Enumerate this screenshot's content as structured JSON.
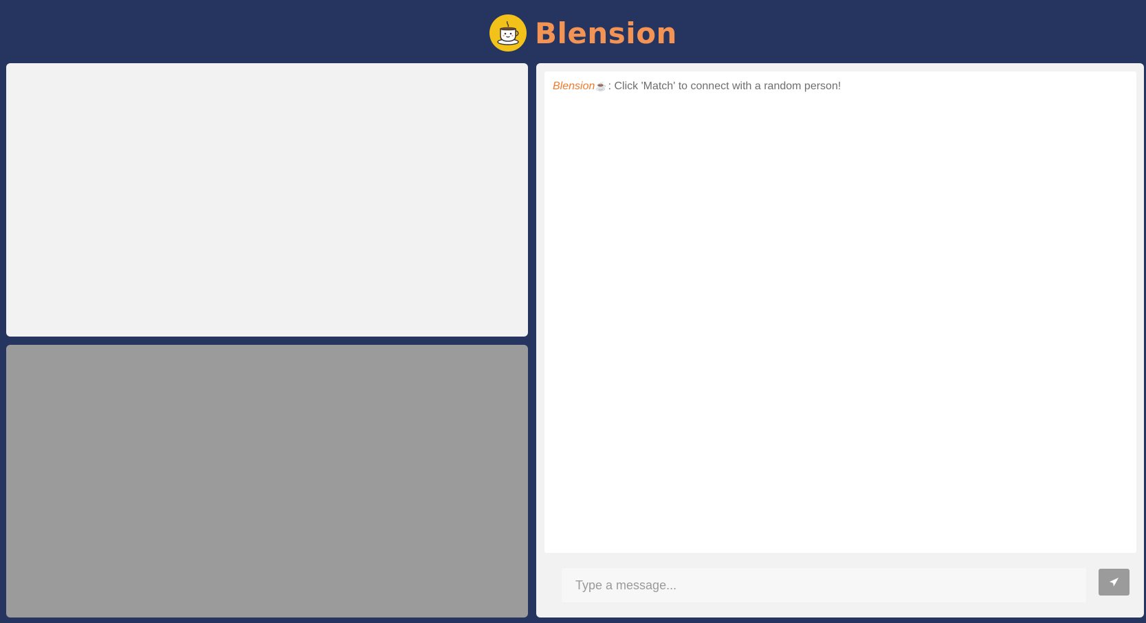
{
  "header": {
    "brand": "Blension",
    "logo_icon": "coffee-cup-mascot-icon",
    "logo_bg_color": "#f3c21a",
    "brand_color": "#f39455"
  },
  "background_color": "#263560",
  "video": {
    "local_bg_color": "#f2f2f2",
    "remote_bg_color": "#9b9b9b"
  },
  "chat": {
    "messages": [
      {
        "sender": "Blension",
        "sender_icon": "☕",
        "separator": ":",
        "text": "Click 'Match' to connect with a random person!"
      }
    ],
    "input": {
      "value": "",
      "placeholder": "Type a message..."
    },
    "send_icon": "paper-plane-icon"
  }
}
